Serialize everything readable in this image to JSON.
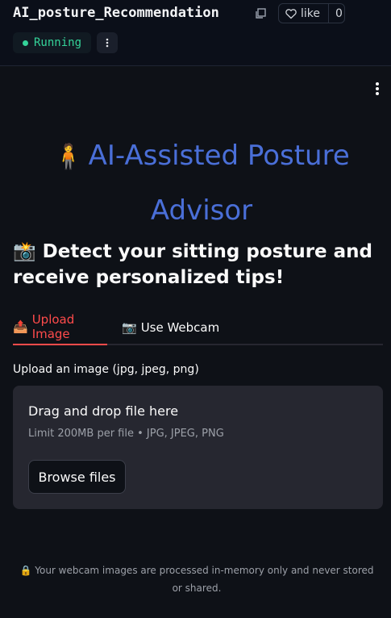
{
  "header": {
    "space_title": "AI_posture_Recommendation",
    "like_label": "like",
    "like_count": "0",
    "status": "Running",
    "status_color": "#34d399"
  },
  "app": {
    "title_emoji": "🧍",
    "title": "AI-Assisted Posture Advisor",
    "title_color": "#4a6fd8",
    "subtitle_emoji": "📸",
    "subtitle": "Detect your sitting posture and receive personalized tips!",
    "tabs": [
      {
        "icon": "📤",
        "label": "Upload Image",
        "active": true
      },
      {
        "icon": "📷",
        "label": "Use Webcam",
        "active": false
      }
    ],
    "accent_color": "#ff4b4b",
    "uploader": {
      "label": "Upload an image (jpg, jpeg, png)",
      "drop_text": "Drag and drop file here",
      "limit_text": "Limit 200MB per file • JPG, JPEG, PNG",
      "browse_label": "Browse files"
    },
    "privacy_icon": "🔒",
    "privacy_note": "Your webcam images are processed in-memory only and never stored or shared."
  }
}
